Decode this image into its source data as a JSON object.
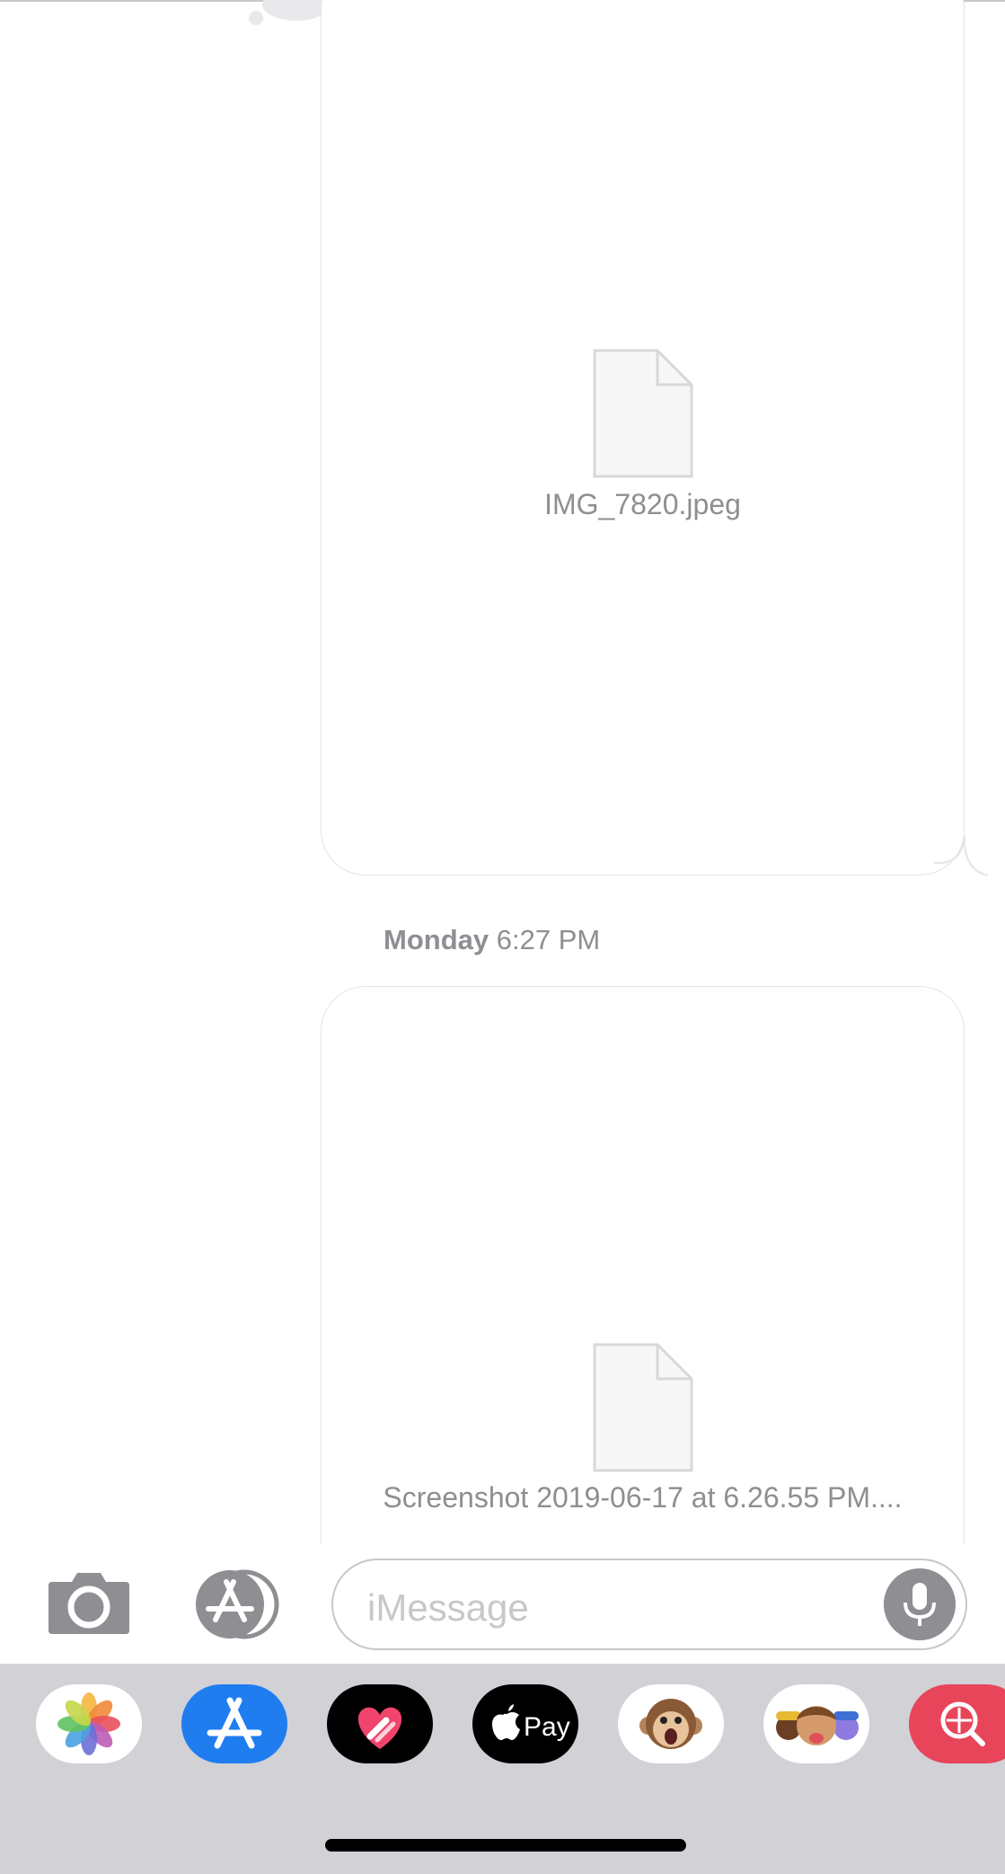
{
  "conversation": {
    "attachments": [
      {
        "file_name": "IMG_7820.jpeg",
        "icon": "document-icon"
      },
      {
        "file_name": "Screenshot 2019-06-17 at 6.26.55 PM....",
        "icon": "document-icon"
      }
    ],
    "timestamp": {
      "day": "Monday",
      "time": "6:27 PM"
    }
  },
  "composer": {
    "placeholder": "iMessage",
    "camera_icon": "camera-icon",
    "apps_icon": "app-store-icon",
    "mic_icon": "microphone-icon"
  },
  "app_tray": {
    "apps": [
      {
        "name": "Photos",
        "icon": "photos-icon"
      },
      {
        "name": "App Store",
        "icon": "app-store-icon"
      },
      {
        "name": "Digital Touch",
        "icon": "heart-icon"
      },
      {
        "name": "Apple Pay",
        "label": "Pay",
        "icon": "apple-pay-icon"
      },
      {
        "name": "Animoji",
        "icon": "monkey-icon"
      },
      {
        "name": "Memoji",
        "icon": "memoji-icon"
      },
      {
        "name": "Images",
        "icon": "globe-search-icon"
      }
    ]
  },
  "colors": {
    "gray_text": "#8e8e93",
    "tray_bg": "#d1d1d6",
    "app_store_blue": "#1f7df0",
    "images_red": "#e8455a"
  }
}
